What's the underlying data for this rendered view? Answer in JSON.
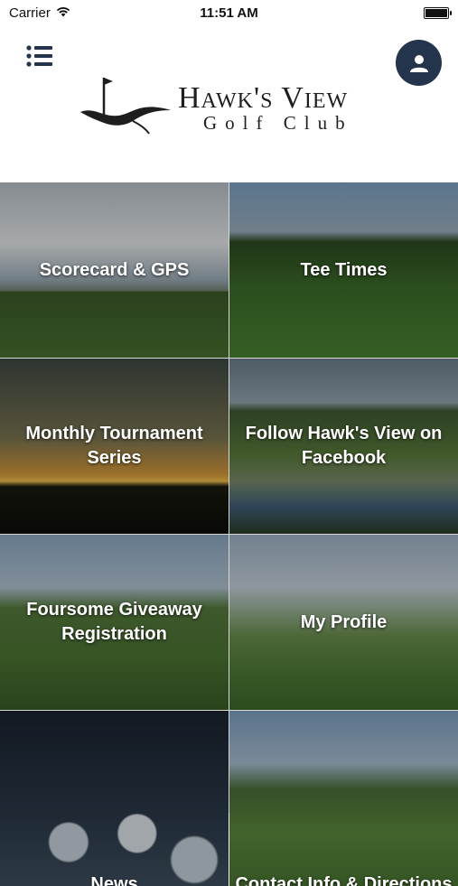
{
  "status_bar": {
    "carrier": "Carrier",
    "time": "11:51 AM"
  },
  "header": {
    "logo_title": "Hawk's View",
    "logo_subtitle": "Golf Club",
    "brand_color": "#23344c"
  },
  "tiles": [
    {
      "label": "Scorecard & GPS"
    },
    {
      "label": "Tee Times"
    },
    {
      "label": "Monthly Tournament\nSeries"
    },
    {
      "label": "Follow Hawk's View on\nFacebook"
    },
    {
      "label": "Foursome Giveaway\nRegistration"
    },
    {
      "label": "My Profile"
    },
    {
      "label": "News"
    },
    {
      "label": "Contact Info & Directions"
    }
  ]
}
